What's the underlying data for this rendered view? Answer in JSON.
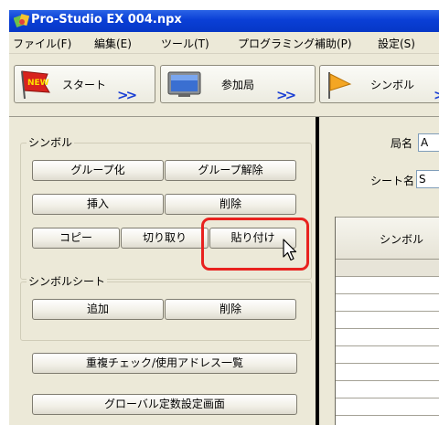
{
  "window": {
    "title": "Pro-Studio EX   004.npx"
  },
  "menu": [
    "ファイル(F)",
    "編集(E)",
    "ツール(T)",
    "プログラミング補助(P)",
    "設定(S)"
  ],
  "toolbar": {
    "start_label": "スタート",
    "station_label": "参加局",
    "symbol_label": "シンボル",
    "new_badge": "NEW"
  },
  "symbol_group": {
    "legend": "シンボル",
    "group": "グループ化",
    "ungroup": "グループ解除",
    "insert": "挿入",
    "delete": "削除",
    "copy": "コピー",
    "cut": "切り取り",
    "paste": "貼り付け"
  },
  "sheet_group": {
    "legend": "シンボルシート",
    "add": "追加",
    "delete": "削除"
  },
  "actions": {
    "duplicate_check": "重複チェック/使用アドレス一覧",
    "global_constant": "グローバル定数設定画面"
  },
  "right": {
    "station_name_label": "局名",
    "station_name_value": "A",
    "sheet_name_label": "シート名",
    "sheet_name_value": "S",
    "grid_header": "シンボル"
  }
}
